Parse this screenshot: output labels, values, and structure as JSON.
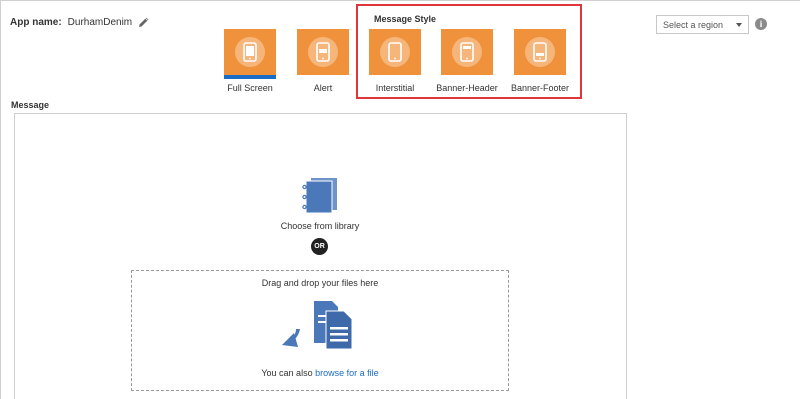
{
  "app": {
    "name_label": "App name:",
    "name_value": "DurhamDenim"
  },
  "tiles": [
    {
      "label": "Full Screen",
      "selected": true,
      "icon": "phone-icon"
    },
    {
      "label": "Alert",
      "selected": false,
      "icon": "phone-alert-icon"
    },
    {
      "label": "Interstitial",
      "selected": false,
      "icon": "phone-interstitial-icon"
    },
    {
      "label": "Banner-Header",
      "selected": false,
      "icon": "phone-banner-header-icon"
    },
    {
      "label": "Banner-Footer",
      "selected": false,
      "icon": "phone-banner-footer-icon"
    }
  ],
  "message_style": {
    "title": "Message Style"
  },
  "region": {
    "placeholder": "Select a region"
  },
  "message": {
    "label": "Message",
    "library_label": "Choose from library",
    "or_text": "OR",
    "drop_title": "Drag and drop your files here",
    "also_text": "You can also",
    "browse_link": "browse for a file"
  },
  "colors": {
    "tile": "#f0913b",
    "tile_circle": "#f6b57a",
    "accent": "#1b6cc4",
    "highlight": "#e2353a",
    "doc_blue": "#4a78b8"
  }
}
